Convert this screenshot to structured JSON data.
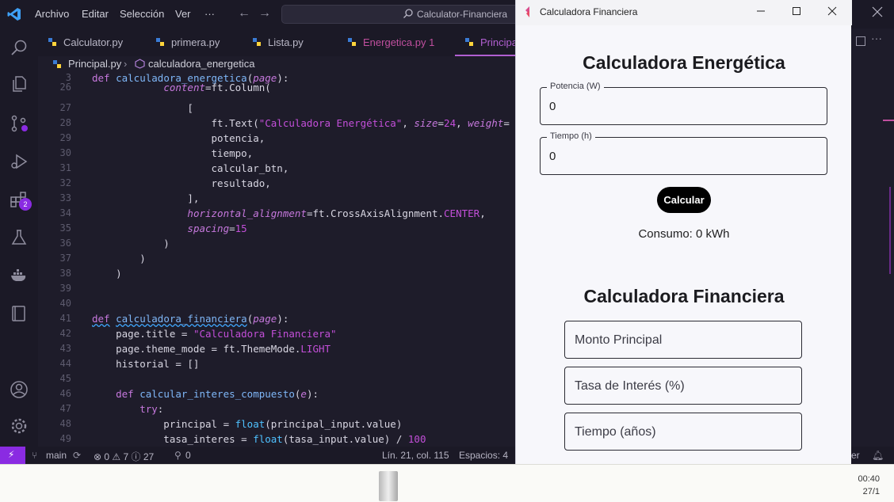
{
  "vscode": {
    "menu": [
      "Archivo",
      "Editar",
      "Selección",
      "Ver",
      "···"
    ],
    "search_text": "Calculator-Financiera",
    "tabs": [
      {
        "label": "Calculator.py",
        "state": "normal"
      },
      {
        "label": "primera.py",
        "state": "normal"
      },
      {
        "label": "Lista.py",
        "state": "normal"
      },
      {
        "label": "Energetica.py 1",
        "state": "modified"
      },
      {
        "label": "Principa",
        "state": "active"
      }
    ],
    "breadcrumb": {
      "file": "Principal.py",
      "symbol": "calculadora_energetica"
    },
    "activity_badge": "2",
    "status": {
      "branch": "main",
      "problems": "⊗ 0 ⚠ 7 ⓘ 27",
      "ports": "0",
      "position": "Lín. 21, col. 115",
      "spaces": "Espacios: 4",
      "truncated_right": "er"
    }
  },
  "code_lines": [
    {
      "n": "3",
      "text": "def calculadora_energetica(page):"
    },
    {
      "n": "26",
      "text": "            content=ft.Column("
    },
    {
      "n": "27",
      "text": "                ["
    },
    {
      "n": "28",
      "text": "                    ft.Text(\"Calculadora Energética\", size=24, weight="
    },
    {
      "n": "29",
      "text": "                    potencia,"
    },
    {
      "n": "30",
      "text": "                    tiempo,"
    },
    {
      "n": "31",
      "text": "                    calcular_btn,"
    },
    {
      "n": "32",
      "text": "                    resultado,"
    },
    {
      "n": "33",
      "text": "                ],"
    },
    {
      "n": "34",
      "text": "                horizontal_alignment=ft.CrossAxisAlignment.CENTER,"
    },
    {
      "n": "35",
      "text": "                spacing=15"
    },
    {
      "n": "36",
      "text": "            )"
    },
    {
      "n": "37",
      "text": "        )"
    },
    {
      "n": "38",
      "text": "    )"
    },
    {
      "n": "39",
      "text": ""
    },
    {
      "n": "40",
      "text": ""
    },
    {
      "n": "41",
      "text": "def calculadora_financiera(page):"
    },
    {
      "n": "42",
      "text": "    page.title = \"Calculadora Financiera\""
    },
    {
      "n": "43",
      "text": "    page.theme_mode = ft.ThemeMode.LIGHT"
    },
    {
      "n": "44",
      "text": "    historial = []"
    },
    {
      "n": "45",
      "text": ""
    },
    {
      "n": "46",
      "text": "    def calcular_interes_compuesto(e):"
    },
    {
      "n": "47",
      "text": "        try:"
    },
    {
      "n": "48",
      "text": "            principal = float(principal_input.value)"
    },
    {
      "n": "49",
      "text": "            tasa_interes = float(tasa_input.value) / 100"
    }
  ],
  "app": {
    "window_title": "Calculadora Financiera",
    "energy": {
      "title": "Calculadora Energética",
      "potencia_label": "Potencia (W)",
      "potencia_value": "0",
      "tiempo_label": "Tiempo (h)",
      "tiempo_value": "0",
      "button": "Calcular",
      "result": "Consumo: 0 kWh"
    },
    "finance": {
      "title": "Calculadora Financiera",
      "principal_placeholder": "Monto Principal",
      "rate_placeholder": "Tasa de Interés (%)",
      "time_placeholder": "Tiempo (años)"
    }
  },
  "taskbar": {
    "time": "00:40",
    "date": "27/1"
  },
  "colors": {
    "accent": "#8a2be2",
    "editor_bg": "#1e1c2a",
    "app_bg": "#f7f7fb"
  }
}
